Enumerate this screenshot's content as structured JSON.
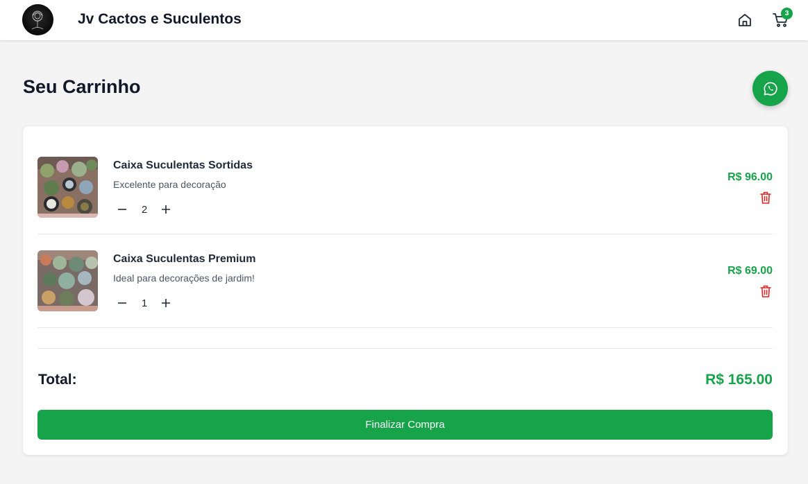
{
  "header": {
    "brand": "Jv Cactos e Suculentos",
    "cart_count": "3"
  },
  "page": {
    "title": "Seu Carrinho"
  },
  "cart": {
    "items": [
      {
        "name": "Caixa Suculentas Sortidas",
        "description": "Excelente para decoração",
        "quantity": "2",
        "price": "R$ 96.00"
      },
      {
        "name": "Caixa Suculentas Premium",
        "description": "Ideal para decorações de jardim!",
        "quantity": "1",
        "price": "R$ 69.00"
      }
    ],
    "total_label": "Total:",
    "total_value": "R$ 165.00",
    "checkout_label": "Finalizar Compra"
  },
  "icons": {
    "home": "home-icon",
    "cart": "cart-icon",
    "whatsapp": "whatsapp-icon",
    "minus": "minus-icon",
    "plus": "plus-icon",
    "trash": "trash-icon"
  },
  "colors": {
    "accent": "#16a34a",
    "danger": "#dc2626",
    "background": "#f4f4f5"
  }
}
